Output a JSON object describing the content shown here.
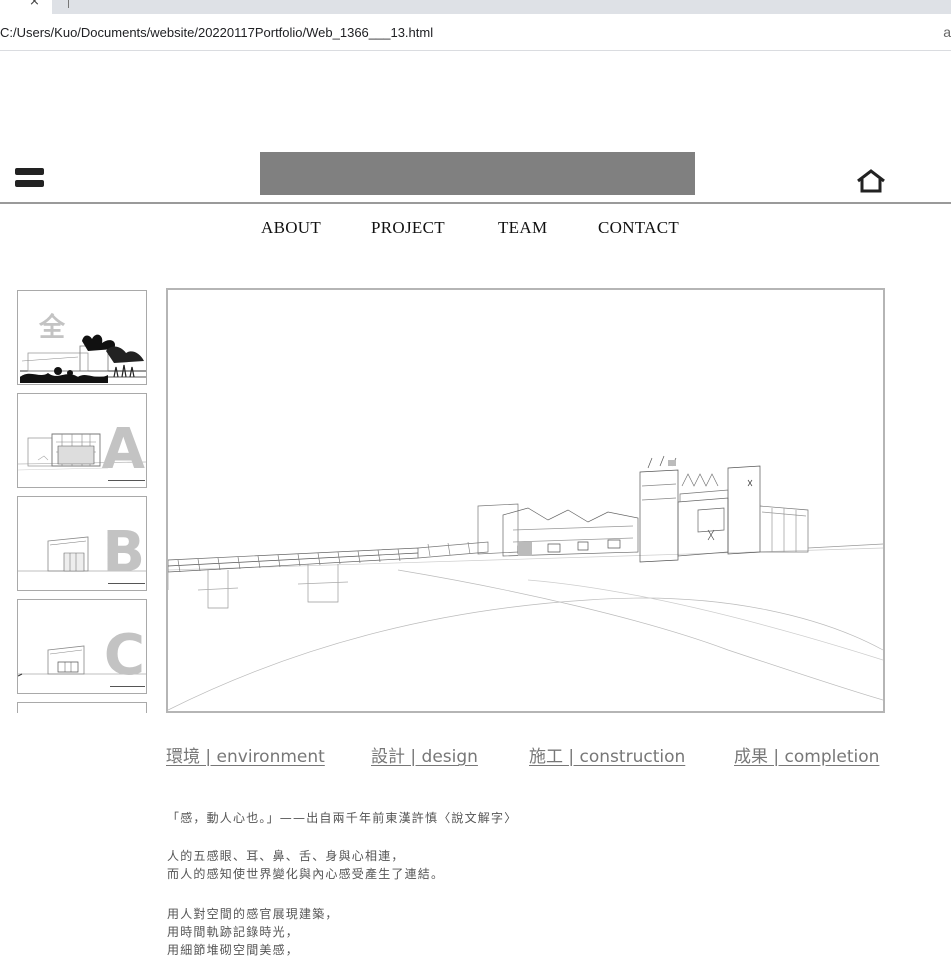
{
  "browser": {
    "tab_close": "×",
    "url": "C:/Users/Kuo/Documents/website/20220117Portfolio/Web_1366___13.html",
    "address_right": "a"
  },
  "nav": {
    "items": [
      "ABOUT",
      "PROJECT",
      "TEAM",
      "CONTACT"
    ]
  },
  "thumbnails": [
    {
      "label": "全"
    },
    {
      "label": "A"
    },
    {
      "label": "B"
    },
    {
      "label": "C"
    }
  ],
  "sections": [
    {
      "label": "環境 | environment"
    },
    {
      "label": "設計 | design"
    },
    {
      "label": "施工 | construction"
    },
    {
      "label": "成果 | completion"
    }
  ],
  "text": {
    "quote": "「感，動人心也。」——出自兩千年前東漢許慎〈說文解字〉",
    "p1_l1": "人的五感眼、耳、鼻、舌、身與心相連，",
    "p1_l2": "而人的感知使世界變化與內心感受產生了連結。",
    "p2_l1": "用人對空間的感官展現建築，",
    "p2_l2": "用時間軌跡記錄時光，",
    "p2_l3": "用細節堆砌空間美感，"
  }
}
